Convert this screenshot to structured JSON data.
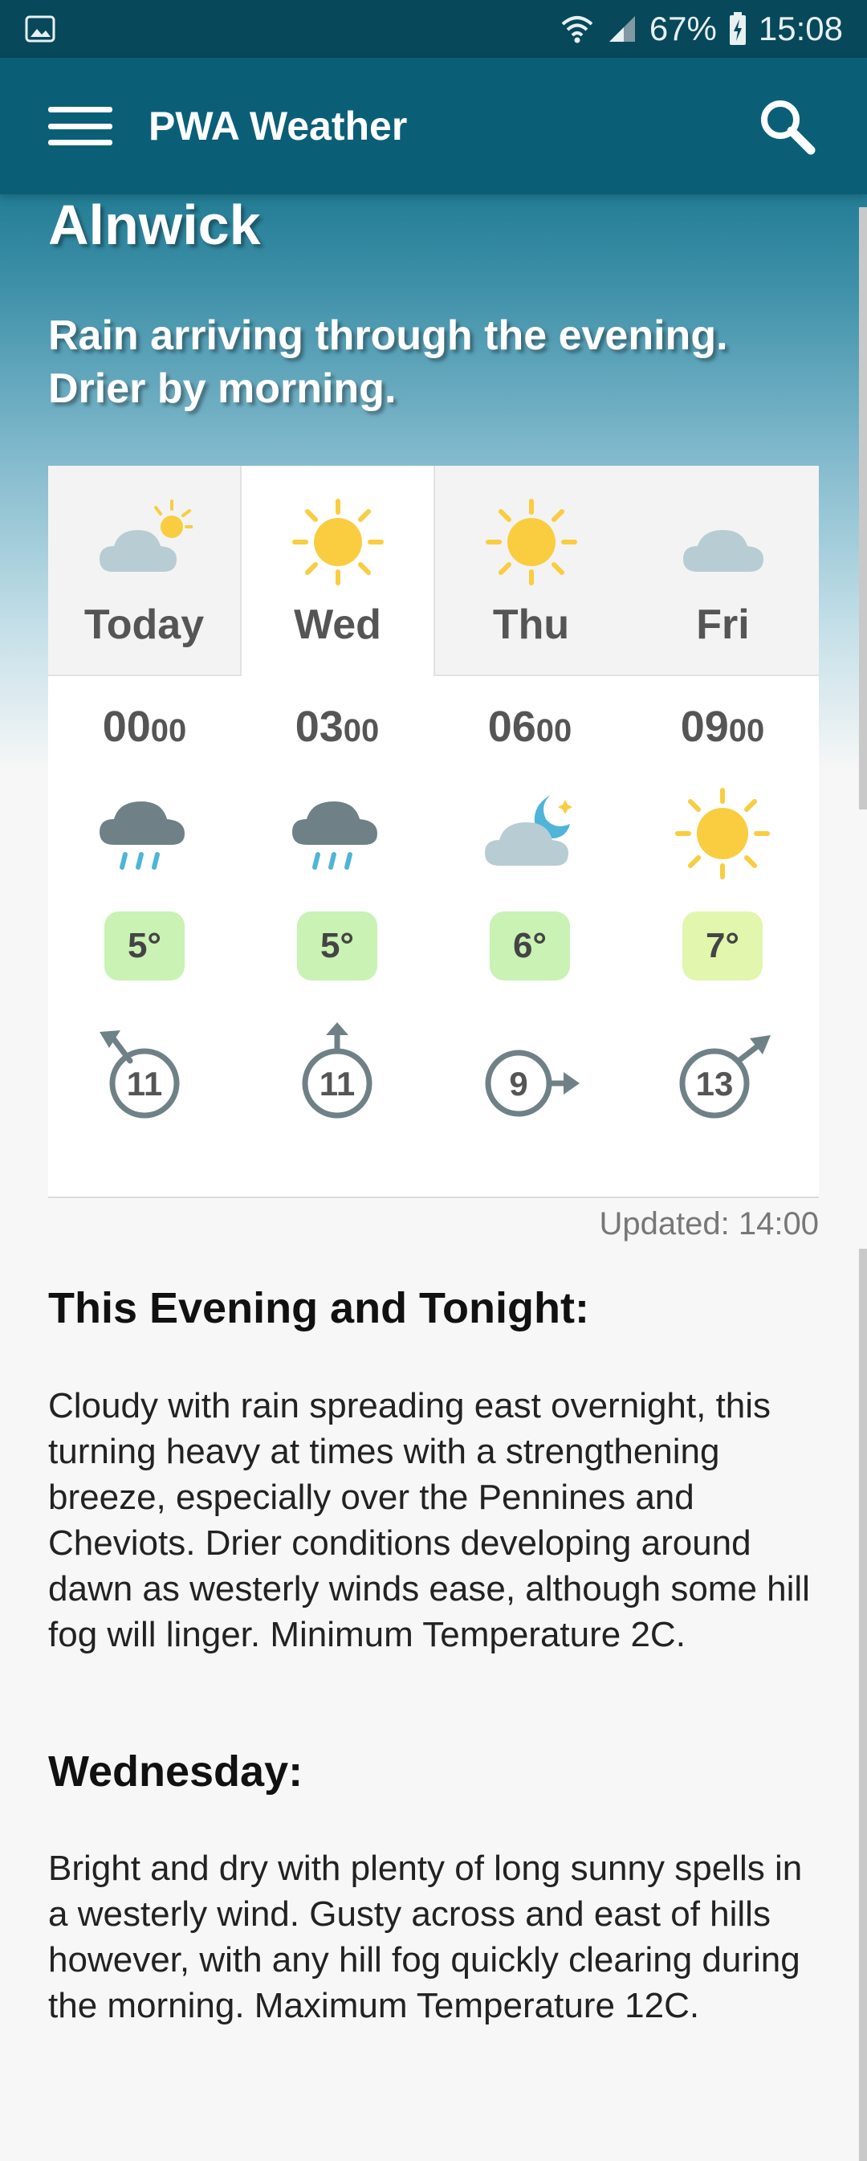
{
  "status_bar": {
    "battery": "67%",
    "time": "15:08",
    "icons": [
      "image-icon",
      "wifi-icon",
      "signal-icon",
      "battery-charging-icon"
    ]
  },
  "app_bar": {
    "title": "PWA Weather",
    "icons": [
      "menu-icon",
      "search-icon"
    ]
  },
  "location": "Alnwick",
  "headline": "Rain arriving through the evening. Drier by morning.",
  "days": [
    {
      "label": "Today",
      "icon": "cloud-sun-icon",
      "active": false
    },
    {
      "label": "Wed",
      "icon": "sun-icon",
      "active": true
    },
    {
      "label": "Thu",
      "icon": "sun-icon",
      "active": false
    },
    {
      "label": "Fri",
      "icon": "cloud-icon",
      "active": false
    }
  ],
  "hours": [
    {
      "hour": "00",
      "minutes": "00",
      "icon": "rain-icon",
      "temp": "5°",
      "temp_color": "#c9f2b4",
      "wind": "11",
      "wind_direction": "north-west"
    },
    {
      "hour": "03",
      "minutes": "00",
      "icon": "rain-icon",
      "temp": "5°",
      "temp_color": "#c9f2b4",
      "wind": "11",
      "wind_direction": "north"
    },
    {
      "hour": "06",
      "minutes": "00",
      "icon": "cloud-moon-icon",
      "temp": "6°",
      "temp_color": "#c9f2b4",
      "wind": "9",
      "wind_direction": "east"
    },
    {
      "hour": "09",
      "minutes": "00",
      "icon": "sun-icon",
      "temp": "7°",
      "temp_color": "#e2f6ae",
      "wind": "13",
      "wind_direction": "north-east"
    }
  ],
  "updated": "Updated: 14:00",
  "sections": [
    {
      "title": "This Evening and Tonight:",
      "body": "Cloudy with rain spreading east overnight, this turning heavy at times with a strengthening breeze, especially over the Pennines and Cheviots. Drier conditions developing around dawn as westerly winds ease, although some hill fog will linger. Minimum Temperature 2C."
    },
    {
      "title": "Wednesday:",
      "body": "Bright and dry with plenty of long sunny spells in a westerly wind. Gusty across and east of hills however, with any hill fog quickly clearing during the morning. Maximum Temperature 12C."
    }
  ],
  "colors": {
    "app_bar": "#0a5f77",
    "status_bar": "#07485b",
    "sun": "#f9cd3f",
    "cloud_light": "#b8ccd3",
    "cloud_dark": "#6f8187",
    "rain": "#4fb4d8",
    "wind": "#6f8187"
  }
}
